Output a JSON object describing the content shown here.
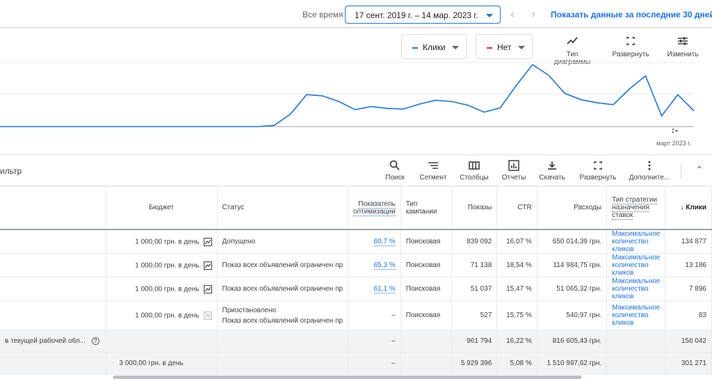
{
  "topbar": {
    "all_time_label": "Все время",
    "date_range": "17 сент. 2019 г. – 14 мар. 2023 г.",
    "prev_arrow": "‹",
    "next_arrow": "›",
    "last30_link": "Показать данные за последние 30 дней"
  },
  "chart_controls": {
    "metric1": "Клики",
    "metric1_color": "#1a73e8",
    "metric2": "Нет",
    "metric2_color": "#d93025",
    "chart_type": "Тип диаграммы",
    "expand": "Развернуть",
    "edit": "Изменить"
  },
  "chart_data": {
    "type": "line",
    "series": [
      {
        "name": "Клики",
        "color": "#1a73e8",
        "values": [
          0,
          0,
          0,
          0,
          0,
          0,
          0,
          0,
          0,
          0,
          0,
          0,
          0,
          0,
          0,
          0,
          0,
          0.02,
          0.2,
          0.51,
          0.49,
          0.4,
          0.27,
          0.32,
          0.29,
          0.28,
          0.36,
          0.42,
          0.4,
          0.34,
          0.23,
          0.3,
          0.66,
          0.99,
          0.82,
          0.53,
          0.43,
          0.38,
          0.35,
          0.6,
          0.81,
          0.17,
          0.51,
          0.25
        ]
      }
    ],
    "x_end_label": "март 2023 г.",
    "grid": true
  },
  "table_toolbar": {
    "filter": "ильтр",
    "search": "Поиск",
    "segment": "Сегмент",
    "columns": "Столбцы",
    "reports": "Отчеты",
    "download": "Скачать",
    "expand": "Развернуть",
    "more": "Дополните...",
    "collapse": "⌃"
  },
  "table": {
    "headers": {
      "budget": "Бюджет",
      "status": "Статус",
      "opt_score": "Показатель оптимизации",
      "campaign_type": "Тип кампании",
      "impressions": "Показы",
      "ctr": "CTR",
      "cost": "Расходы",
      "bid_strategy": "Тип стратегии назначения ставок",
      "clicks": "↓ Клики"
    },
    "rows": [
      {
        "budget": "1 000,00 грн. в день",
        "status": "Допущено",
        "status2": "",
        "opt": "60,7 %",
        "type": "Поисковая",
        "impressions": "839 092",
        "ctr": "16,07 %",
        "cost": "650 014,39 грн.",
        "strategy": "Максимальное количество кликов",
        "clicks": "134 877"
      },
      {
        "budget": "1 000,00 грн. в день",
        "status": "Показ всех объявлений ограничен пр",
        "status2": "",
        "opt": "65,3 %",
        "type": "Поисковая",
        "impressions": "71 138",
        "ctr": "18,54 %",
        "cost": "114 984,75 грн.",
        "strategy": "Максимальное количество кликов",
        "clicks": "13 186"
      },
      {
        "budget": "1 000,00 грн. в день",
        "status": "Показ всех объявлений ограничен пр",
        "status2": "",
        "opt": "61,1 %",
        "type": "Поисковая",
        "impressions": "51 037",
        "ctr": "15,47 %",
        "cost": "51 065,32 грн.",
        "strategy": "Максимальное количество кликов",
        "clicks": "7 896"
      },
      {
        "budget": "1 000,00 грн. в день",
        "status": "Приостановлено",
        "status2": "Показ всех объявлений ограничен пр",
        "opt": "–",
        "type": "Поисковая",
        "impressions": "527",
        "ctr": "15,75 %",
        "cost": "540,97 грн.",
        "strategy": "Максимальное количество кликов",
        "clicks": "83"
      }
    ],
    "summary1": {
      "label": "в текущей рабочей обл...",
      "help": "?",
      "opt": "–",
      "impressions": "961 794",
      "ctr": "16,22 %",
      "cost": "816 605,43 грн.",
      "clicks": "156 042"
    },
    "summary2": {
      "budget": "3 000,00 грн. в день",
      "opt": "–",
      "impressions": "5 929 396",
      "ctr": "5,08 %",
      "cost": "1 510 997,62 грн.",
      "clicks": "301 271"
    }
  }
}
